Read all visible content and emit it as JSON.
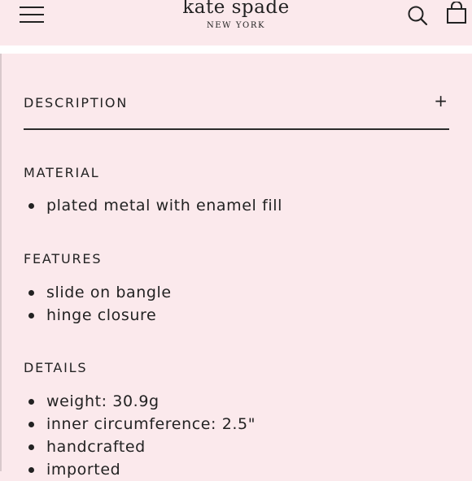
{
  "header": {
    "brand_name": "kate spade",
    "brand_sub": "NEW YORK",
    "menu_icon": "hamburger-menu-icon",
    "search_icon": "search-icon",
    "bag_icon": "shopping-bag-icon"
  },
  "accordion": {
    "label": "DESCRIPTION",
    "toggle": "+"
  },
  "sections": [
    {
      "title": "MATERIAL",
      "items": [
        "plated metal with enamel fill"
      ]
    },
    {
      "title": "FEATURES",
      "items": [
        "slide on bangle",
        "hinge closure"
      ]
    },
    {
      "title": "DETAILS",
      "items": [
        "weight: 30.9g",
        "inner circumference: 2.5\"",
        "handcrafted",
        "imported"
      ]
    }
  ],
  "colors": {
    "background": "#fbe9ec",
    "text": "#222222",
    "band": "#ffffff"
  }
}
